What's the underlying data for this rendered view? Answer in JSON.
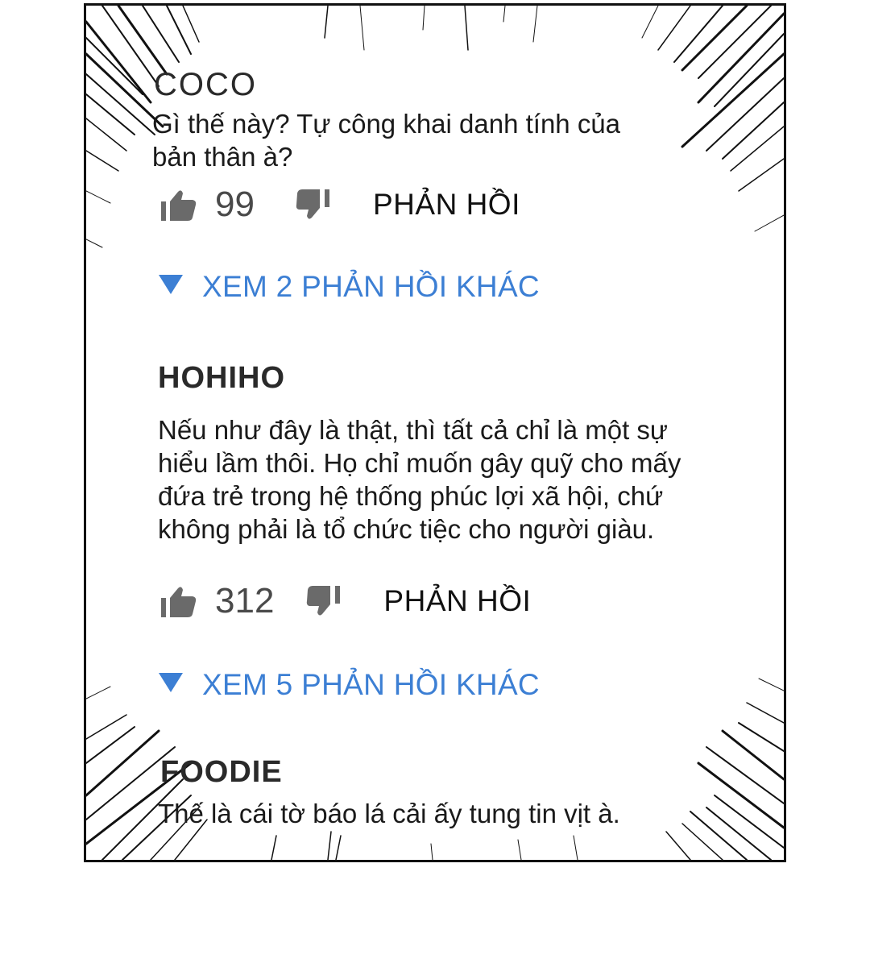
{
  "comments": [
    {
      "username": "COCO",
      "text_lines": [
        "Gì thế này? Tự công khai danh tính của",
        "bản thân à?"
      ],
      "likes": "99",
      "reply_label": "PHẢN HỒI",
      "more_replies": "XEM 2 PHẢN HỒI KHÁC"
    },
    {
      "username": "HOHIHO",
      "text_lines": [
        "Nếu như đây là thật, thì tất cả chỉ là một sự",
        "hiểu lầm thôi. Họ chỉ muốn gây quỹ cho mấy",
        "đứa trẻ trong hệ thống phúc lợi xã hội, chứ",
        "không phải là tổ chức tiệc cho người giàu."
      ],
      "likes": "312",
      "reply_label": "PHẢN HỒI",
      "more_replies": "XEM 5 PHẢN HỒI KHÁC"
    },
    {
      "username": "FOODIE",
      "text_lines": [
        "Thế là cái tờ báo lá cải ấy tung tin vịt à."
      ]
    }
  ],
  "icons": {
    "like": "thumbs-up-icon",
    "dislike": "thumbs-down-icon",
    "expand": "triangle-down-icon"
  },
  "colors": {
    "link_blue": "#3c7fd4",
    "icon_gray": "#6a6a6a",
    "text": "#1a1a1a",
    "border": "#111111"
  }
}
